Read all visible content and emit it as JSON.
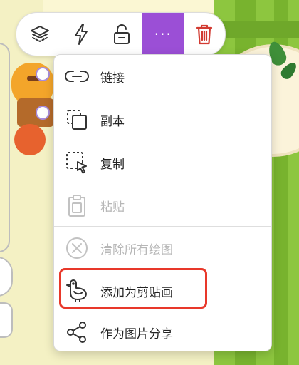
{
  "toolbar": {
    "buttons": [
      {
        "icon": "layers-icon",
        "active": false
      },
      {
        "icon": "lightning-icon",
        "active": false
      },
      {
        "icon": "unlock-icon",
        "active": false
      },
      {
        "icon": "more-icon",
        "label": "···",
        "active": true
      },
      {
        "icon": "trash-icon",
        "active": false
      }
    ],
    "accent_color": "#9b4fd6",
    "delete_color": "#d23b32"
  },
  "menu": {
    "items": [
      {
        "label": "链接",
        "icon": "link-icon",
        "enabled": true
      },
      {
        "label": "副本",
        "icon": "duplicate-icon",
        "enabled": true
      },
      {
        "label": "复制",
        "icon": "copy-icon",
        "enabled": true
      },
      {
        "label": "粘贴",
        "icon": "paste-icon",
        "enabled": false
      },
      {
        "label": "清除所有绘图",
        "icon": "clear-drawings-icon",
        "enabled": false
      },
      {
        "label": "添加为剪贴画",
        "icon": "bird-icon",
        "enabled": true,
        "highlighted": true
      },
      {
        "label": "作为图片分享",
        "icon": "share-icon",
        "enabled": true
      }
    ],
    "highlight_color": "#e8382a"
  }
}
